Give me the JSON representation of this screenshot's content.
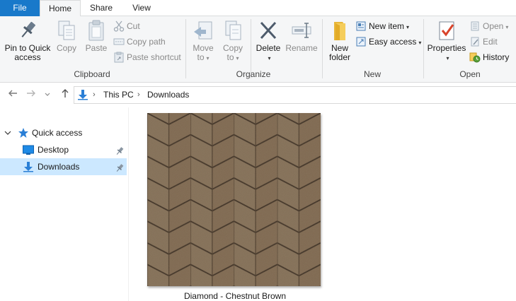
{
  "tabs": {
    "file": "File",
    "home": "Home",
    "share": "Share",
    "view": "View"
  },
  "ribbon": {
    "clipboard": {
      "label": "Clipboard",
      "pin_to_quick_access_line1": "Pin to Quick",
      "pin_to_quick_access_line2": "access",
      "copy": "Copy",
      "paste": "Paste",
      "cut": "Cut",
      "copy_path": "Copy path",
      "paste_shortcut": "Paste shortcut"
    },
    "organize": {
      "label": "Organize",
      "move_to_line1": "Move",
      "move_to_line2": "to",
      "copy_to_line1": "Copy",
      "copy_to_line2": "to",
      "delete": "Delete",
      "rename": "Rename"
    },
    "new": {
      "label": "New",
      "new_folder_line1": "New",
      "new_folder_line2": "folder",
      "new_item": "New item",
      "easy_access": "Easy access"
    },
    "open": {
      "label": "Open",
      "properties": "Properties",
      "open": "Open",
      "edit": "Edit",
      "history": "History"
    }
  },
  "address": {
    "crumbs": [
      "This PC",
      "Downloads"
    ]
  },
  "nav_pane": {
    "quick_access": "Quick access",
    "items": [
      {
        "label": "Desktop",
        "pinned": true,
        "selected": false
      },
      {
        "label": "Downloads",
        "pinned": true,
        "selected": true
      }
    ]
  },
  "files": [
    {
      "name": "Diamond - Chestnut Brown",
      "thumbnail": "brown-chevron-tile-pattern"
    }
  ],
  "colors": {
    "file_tab": "#1979ca",
    "selection": "#cce8ff",
    "ribbon_bg": "#f5f6f7",
    "tile_brown": "#806a53"
  }
}
